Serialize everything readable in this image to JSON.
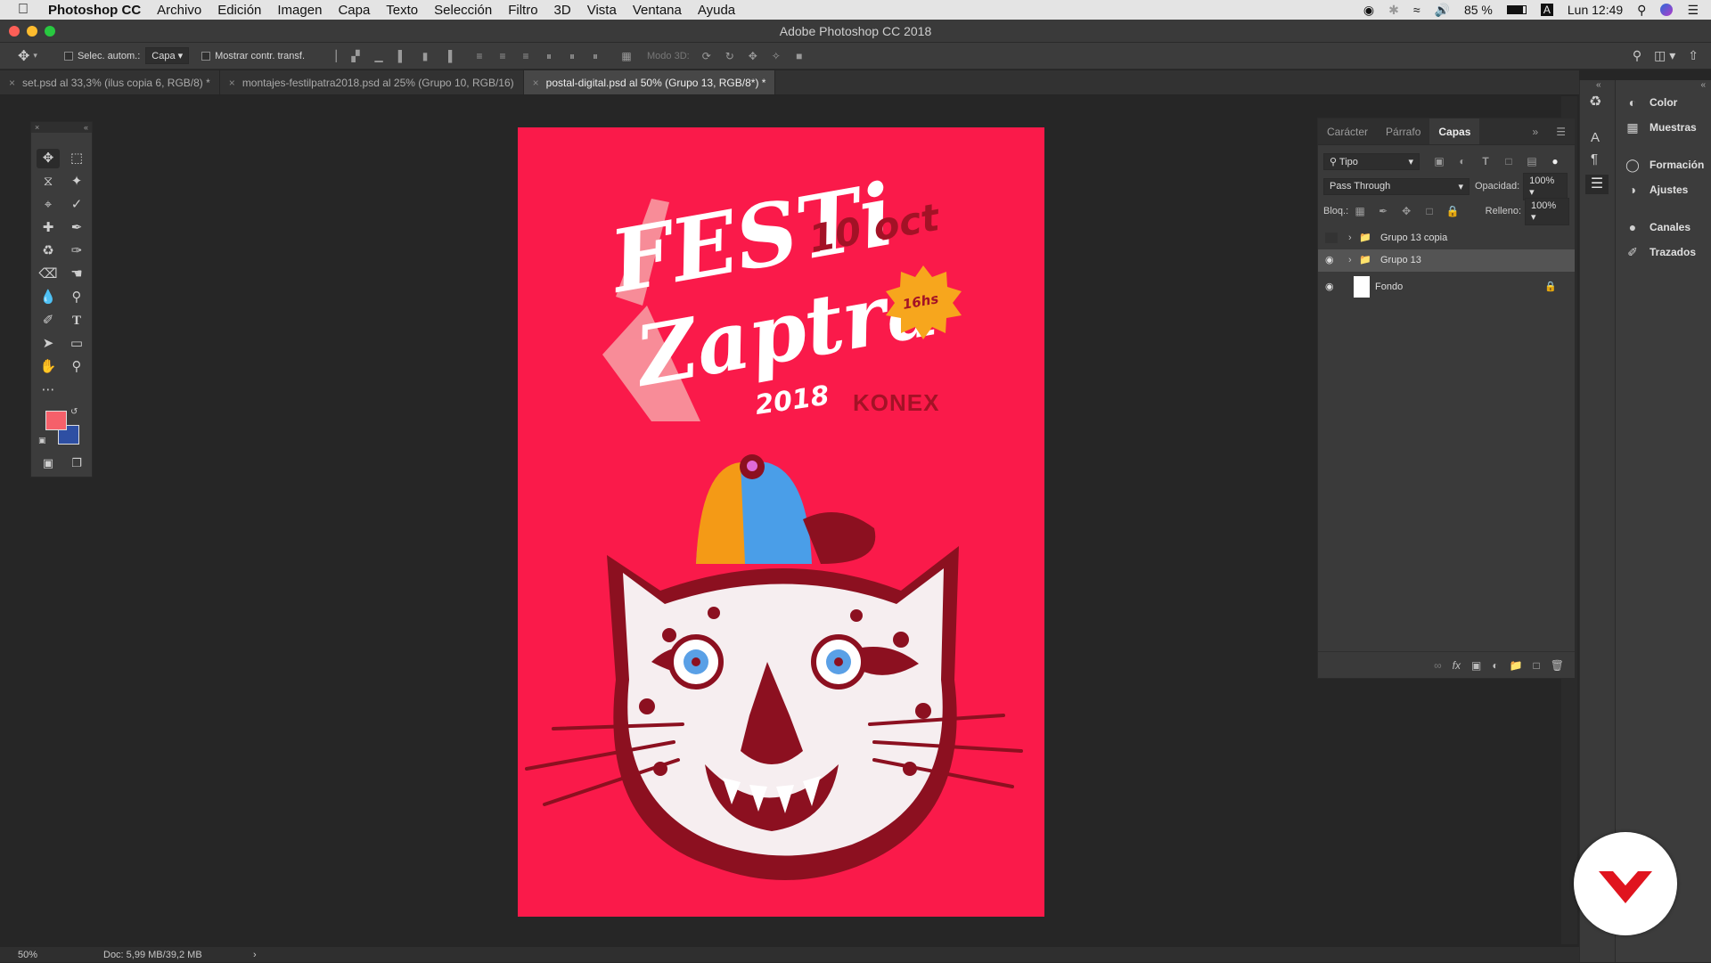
{
  "menubar": {
    "app_name": "Photoshop CC",
    "items": [
      "Archivo",
      "Edición",
      "Imagen",
      "Capa",
      "Texto",
      "Selección",
      "Filtro",
      "3D",
      "Vista",
      "Ventana",
      "Ayuda"
    ],
    "battery": "85 %",
    "clock": "Lun 12:49"
  },
  "window": {
    "title": "Adobe Photoshop CC 2018"
  },
  "options": {
    "auto_select_label": "Selec. autom.:",
    "auto_select_value": "Capa",
    "show_transform_label": "Mostrar contr. transf.",
    "mode3d_label": "Modo 3D:"
  },
  "tabs": [
    {
      "label": "set.psd al 33,3% (ilus copia 6, RGB/8) *",
      "active": false
    },
    {
      "label": "montajes-festilpatra2018.psd al 25% (Grupo 10, RGB/16)",
      "active": false
    },
    {
      "label": "postal-digital.psd al 50% (Grupo 13, RGB/8*) *",
      "active": true
    }
  ],
  "colors": {
    "foreground": "#f5606a",
    "background": "#2e4fa3",
    "poster_bg": "#fa1a4a",
    "poster_dark": "#8c1020"
  },
  "poster": {
    "line1": "FESTi",
    "line2": "Zaptra",
    "date": "10 oct",
    "time_badge": "16hs",
    "year": "2018",
    "sponsor": "KONEX"
  },
  "layers_panel": {
    "tabs": [
      "Carácter",
      "Párrafo",
      "Capas"
    ],
    "filter_value": "Tipo",
    "blend_mode": "Pass Through",
    "opacity_label": "Opacidad:",
    "opacity_value": "100%",
    "lock_label": "Bloq.:",
    "fill_label": "Relleno:",
    "fill_value": "100%",
    "layers": [
      {
        "name": "Grupo 13 copia",
        "visible": false,
        "type": "group"
      },
      {
        "name": "Grupo 13",
        "visible": true,
        "type": "group",
        "selected": true
      },
      {
        "name": "Fondo",
        "visible": true,
        "type": "layer",
        "locked": true
      }
    ]
  },
  "right_panels": [
    {
      "label": "Color",
      "icon": "color-wheel-icon"
    },
    {
      "label": "Muestras",
      "icon": "swatches-grid-icon"
    },
    {
      "label": "Formación",
      "icon": "lightbulb-icon"
    },
    {
      "label": "Ajustes",
      "icon": "adjustments-icon"
    },
    {
      "label": "Canales",
      "icon": "channels-icon"
    },
    {
      "label": "Trazados",
      "icon": "paths-icon"
    }
  ],
  "status": {
    "zoom": "50%",
    "doc_size": "Doc: 5,99 MB/39,2 MB"
  }
}
